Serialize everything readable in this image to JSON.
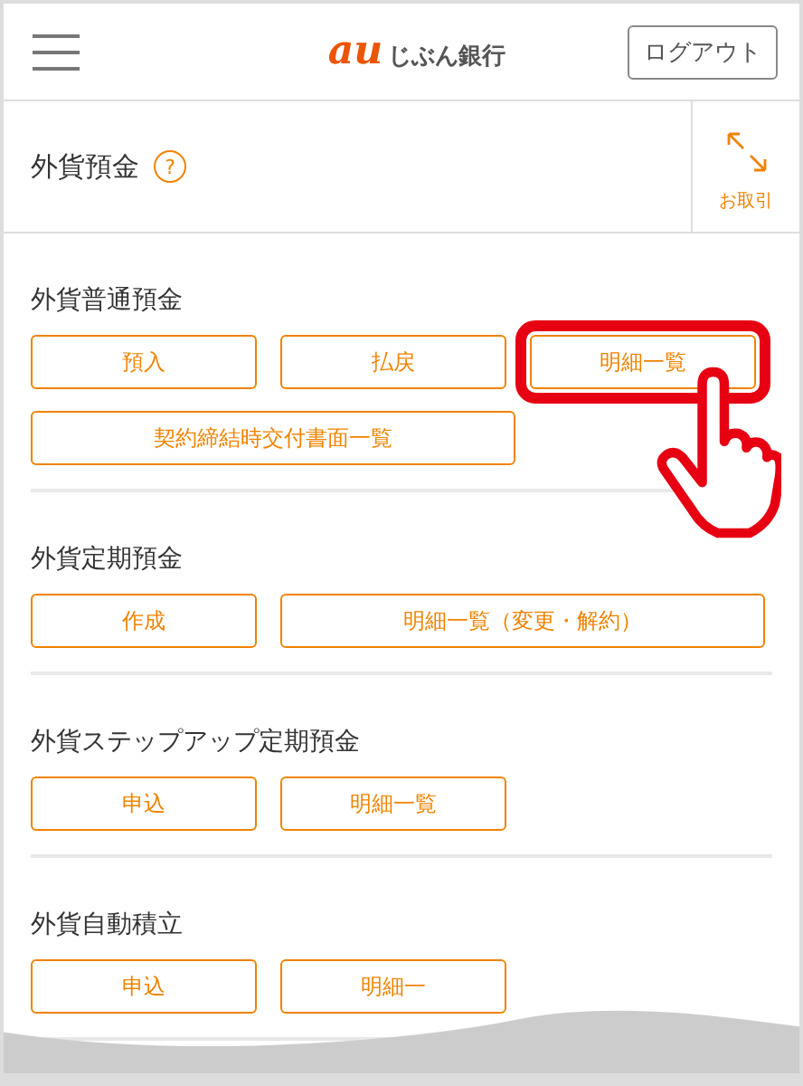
{
  "header": {
    "logo_mark": "au",
    "logo_text": "じぶん銀行",
    "logout": "ログアウト"
  },
  "page": {
    "title": "外貨預金",
    "help": "?",
    "action": "お取引"
  },
  "sections": [
    {
      "title": "外貨普通預金",
      "buttons": [
        {
          "label": "預入",
          "kind": "normal",
          "highlighted": false
        },
        {
          "label": "払戻",
          "kind": "normal",
          "highlighted": false
        },
        {
          "label": "明細一覧",
          "kind": "normal",
          "highlighted": true
        },
        {
          "label": "契約締結時交付書面一覧",
          "kind": "wide",
          "highlighted": false
        }
      ]
    },
    {
      "title": "外貨定期預金",
      "buttons": [
        {
          "label": "作成",
          "kind": "normal",
          "highlighted": false
        },
        {
          "label": "明細一覧（変更・解約）",
          "kind": "wide",
          "highlighted": false
        }
      ]
    },
    {
      "title": "外貨ステップアップ定期預金",
      "buttons": [
        {
          "label": "申込",
          "kind": "normal",
          "highlighted": false
        },
        {
          "label": "明細一覧",
          "kind": "normal",
          "highlighted": false
        }
      ]
    },
    {
      "title": "外貨自動積立",
      "buttons": [
        {
          "label": "申込",
          "kind": "normal",
          "highlighted": false
        },
        {
          "label": "明細一",
          "kind": "normal",
          "highlighted": false
        }
      ]
    }
  ]
}
